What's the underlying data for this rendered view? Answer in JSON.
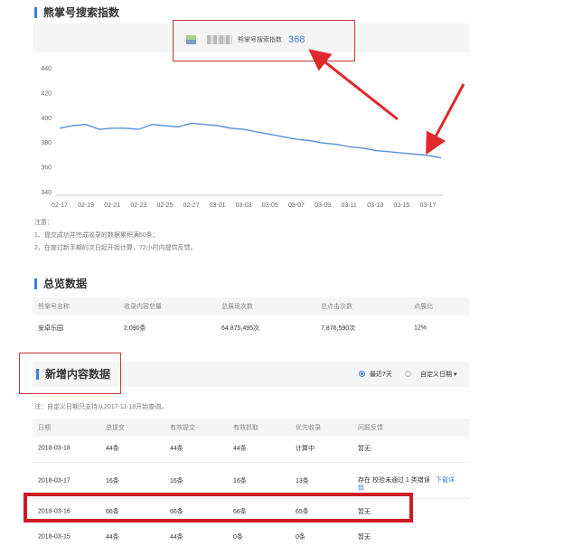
{
  "search_index": {
    "title": "熊掌号搜索指数",
    "legend_label": "熊掌号搜索指数",
    "legend_value": "368"
  },
  "chart_data": {
    "type": "line",
    "x": [
      "02-17",
      "02-18",
      "02-19",
      "02-20",
      "02-21",
      "02-22",
      "02-23",
      "02-24",
      "02-25",
      "02-26",
      "02-27",
      "02-28",
      "03-01",
      "03-02",
      "03-03",
      "03-04",
      "03-05",
      "03-06",
      "03-07",
      "03-08",
      "03-09",
      "03-10",
      "03-11",
      "03-12",
      "03-13",
      "03-14",
      "03-15",
      "03-16",
      "03-17",
      "03-18"
    ],
    "xticks": [
      "02-17",
      "02-19",
      "02-21",
      "02-23",
      "02-25",
      "02-27",
      "03-01",
      "03-03",
      "03-05",
      "03-07",
      "03-09",
      "03-11",
      "03-13",
      "03-15",
      "03-17"
    ],
    "yticks": [
      340,
      360,
      380,
      400,
      420,
      440
    ],
    "ylim": [
      340,
      440
    ],
    "series": [
      {
        "values": [
          392,
          394,
          395,
          391,
          392,
          392,
          391,
          395,
          394,
          393,
          396,
          395,
          394,
          392,
          391,
          389,
          387,
          385,
          383,
          382,
          380,
          379,
          377,
          376,
          374,
          373,
          372,
          371,
          370,
          368
        ]
      }
    ],
    "line_color": "#5b8fd8",
    "grid": false
  },
  "notes": {
    "title": "注意：",
    "items": [
      "1、提交成功并完成收录的数据累积满50条；",
      "2、在度过新手期的次日起开始计算，72小时内提供反馈。"
    ]
  },
  "overview": {
    "title": "总览数据",
    "headers": [
      "熊掌号名称",
      "收录内容总量",
      "总展现次数",
      "总点击次数",
      "点展比"
    ],
    "row": [
      "安卓乐园",
      "2,090条",
      "64,875,495次",
      "7,876,590次",
      "12%"
    ]
  },
  "new_content": {
    "title": "新增内容数据",
    "option_recent": "最近7天",
    "option_custom": "自定义日期 ▾",
    "note": "注：自定义日期只支持从2017-11-18开始查询。",
    "headers": [
      "日期",
      "总提交",
      "有效提交",
      "有效抓取",
      "优先收录",
      "问题反馈"
    ],
    "rows": [
      [
        "2018-03-18",
        "44条",
        "44条",
        "44条",
        "计算中",
        "暂无"
      ],
      [
        "2018-03-17",
        "16条",
        "16条",
        "16条",
        "13条",
        "存在 校验未通过 1 类错误"
      ],
      [
        "2018-03-16",
        "66条",
        "66条",
        "66条",
        "65条",
        "暂无"
      ],
      [
        "2018-03-15",
        "44条",
        "44条",
        "0条",
        "0条",
        "暂无"
      ]
    ],
    "download_detail": "下载详情"
  },
  "colors": {
    "accent": "#3f7fd6",
    "annotation": "#c9353a",
    "highlight": "#cc1c24"
  }
}
